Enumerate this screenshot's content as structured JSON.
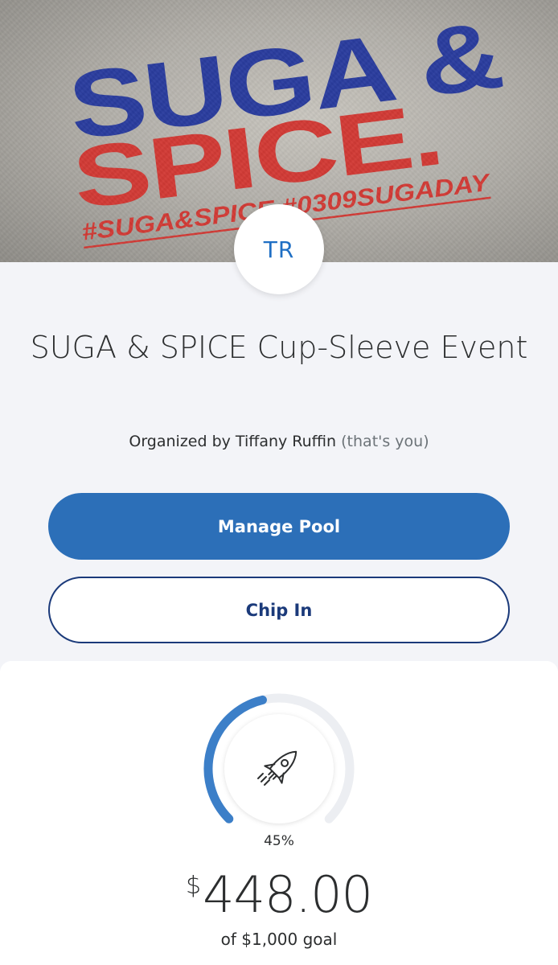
{
  "banner": {
    "line1": "SUGA &",
    "line2": "SPICE.",
    "hashtags": "#SUGA&SPICE #0309SUGADAY",
    "blue": "#2a3c9e",
    "red": "#d23a35"
  },
  "avatar": {
    "initials": "TR"
  },
  "pool": {
    "title": "SUGA & SPICE Cup-Sleeve Event",
    "organizer_prefix": "Organized by Tiffany Ruffin",
    "organizer_suffix": "(that's you)"
  },
  "actions": {
    "manage_label": "Manage Pool",
    "chip_label": "Chip In"
  },
  "progress": {
    "percent_label": "45%",
    "fraction": 0.45,
    "icon": "rocket-icon",
    "currency_symbol": "$",
    "amount": "448.00",
    "goal_text": "of $1,000 goal",
    "accent": "#3c7fc8",
    "track": "#eceef2"
  }
}
